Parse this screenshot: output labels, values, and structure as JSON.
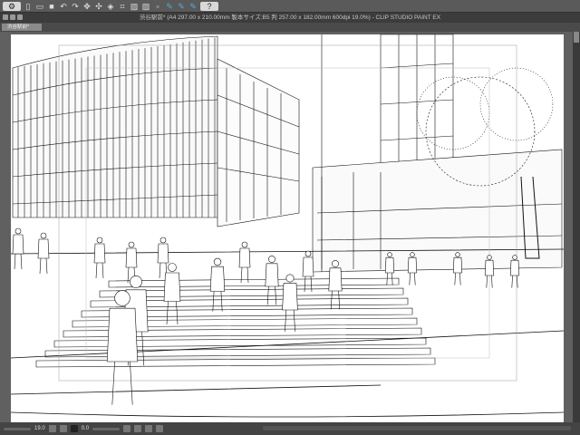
{
  "app": {
    "title": "渋谷駅前* (A4 297.00 x 210.00mm 製本サイズ:B5 判 257.00 x 182.00mm 600dpi 19.0%) - CLIP STUDIO PAINT EX"
  },
  "tab": {
    "label": "渋谷駅前*"
  },
  "toolbar": {
    "icons": [
      "menu-icon",
      "new-icon",
      "open-icon",
      "save-icon",
      "spin-icon",
      "undo-icon",
      "redo-icon",
      "transform-icon",
      "move-icon",
      "fill-icon",
      "crop-icon",
      "layer-icon",
      "layer2-icon",
      "layer3-icon",
      "pen-icon",
      "pen2-icon",
      "pen3-icon",
      "help-icon"
    ]
  },
  "status": {
    "zoom": "19.0",
    "angle": "0.0"
  }
}
